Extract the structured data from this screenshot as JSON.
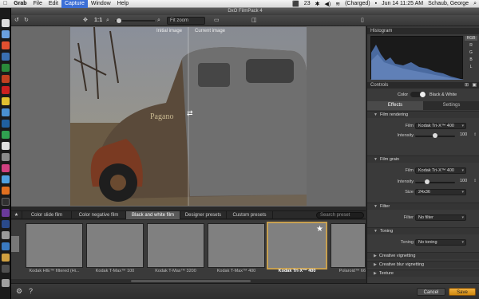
{
  "menubar": {
    "apple": "",
    "app_name": "Grab",
    "items": [
      "File",
      "Edit",
      "Capture",
      "Window",
      "Help"
    ],
    "active_item": "Capture",
    "status": {
      "badge": "23",
      "battery": "(Charged)",
      "datetime": "Jun 14 11:25 AM",
      "user": "Schaub, George"
    }
  },
  "window": {
    "title": "DxO FilmPack 4"
  },
  "toolbar": {
    "zoom_ratio": "1:1",
    "fit_zoom": "Fit zoom"
  },
  "viewer": {
    "left_label": "Initial image",
    "right_label": "Current image"
  },
  "preset_tabs": [
    {
      "label": "Color slide film",
      "active": false
    },
    {
      "label": "Color negative film",
      "active": false
    },
    {
      "label": "Black and white film",
      "active": true
    },
    {
      "label": "Designer presets",
      "active": false
    },
    {
      "label": "Custom presets",
      "active": false
    }
  ],
  "search": {
    "placeholder": "Search preset"
  },
  "presets": [
    "Kodak HIE™ filtered (Hi...",
    "Kodak T-Max™ 100",
    "Kodak T-Max™ 3200",
    "Kodak T-Max™ 400",
    "Kodak Tri-X™ 400",
    "Polaroid™ 66"
  ],
  "selected_preset_index": 4,
  "right_panel": {
    "histogram_title": "Histogram",
    "histogram_channels": [
      "RGB",
      "R",
      "G",
      "B",
      "L"
    ],
    "controls_title": "Controls",
    "color_label": "Color",
    "bw_label": "Black & White",
    "tabs": {
      "effects": "Effects",
      "settings": "Settings"
    },
    "film_rendering": {
      "title": "Film rendering",
      "film_label": "Film",
      "film_value": "Kodak Tri-X™ 400",
      "intensity_label": "Intensity",
      "intensity_value": "100",
      "intensity_level": 0.5
    },
    "film_grain": {
      "title": "Film grain",
      "film_label": "Film",
      "film_value": "Kodak Tri-X™ 400",
      "intensity_label": "Intensity",
      "intensity_value": "100",
      "intensity_level": 0.3,
      "size_label": "Size",
      "size_value": "24x36"
    },
    "filter": {
      "title": "Filter",
      "label": "Filter",
      "value": "No filter"
    },
    "toning": {
      "title": "Toning",
      "label": "Toning",
      "value": "No toning"
    },
    "collapsed": [
      "Creative vignetting",
      "Creative blur vignetting",
      "Texture"
    ]
  },
  "footer": {
    "cancel": "Cancel",
    "save": "Save"
  },
  "colors": {
    "accent": "#3c6fd6",
    "save": "#e0a020",
    "selection": "#c8a050"
  }
}
